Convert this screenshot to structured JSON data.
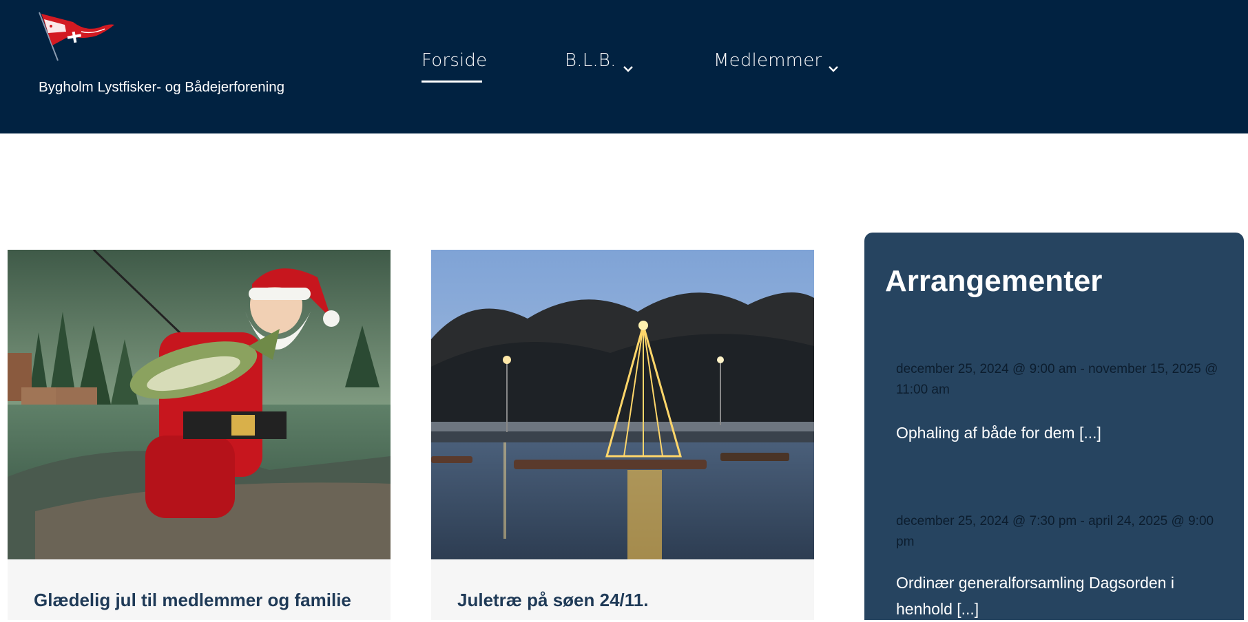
{
  "header": {
    "site_title": "Bygholm Lystfisker- og Bådejerforening",
    "logo_icon": "flag-logo-icon",
    "nav": [
      {
        "label": "Forside",
        "active": true
      },
      {
        "label": "B.L.B.",
        "has_dropdown": true
      },
      {
        "label": "Medlemmer",
        "has_dropdown": true
      }
    ]
  },
  "posts": [
    {
      "title": "Glædelig jul til medlemmer og familie",
      "image": "santa-fishing-image"
    },
    {
      "title": "Juletræ på søen 24/11.",
      "image": "christmas-tree-lake-image"
    }
  ],
  "sidebar": {
    "title": "Arrangementer",
    "events": [
      {
        "date": "december 25, 2024 @ 9:00 am - november 15, 2025 @ 11:00 am",
        "title": "Ophaling af både for dem [...]"
      },
      {
        "date": "december 25, 2024 @ 7:30 pm - april 24, 2025 @ 9:00 pm",
        "title": "Ordinær generalforsamling Dagsorden i henhold [...]"
      }
    ]
  },
  "colors": {
    "header_bg": "#012241",
    "sidebar_bg": "#264460",
    "post_title": "#1f3a57",
    "card_body_bg": "#f6f6f6"
  }
}
